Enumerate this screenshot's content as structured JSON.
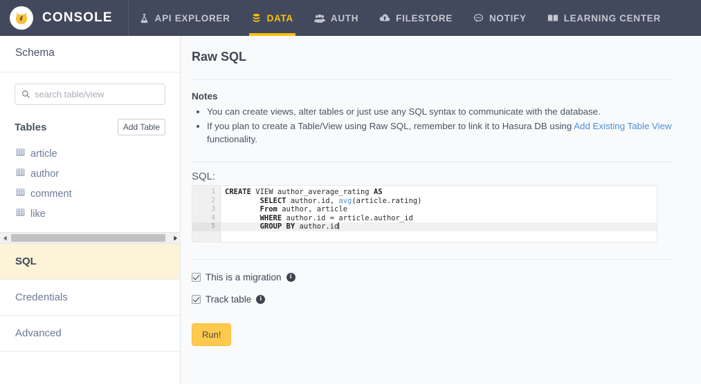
{
  "topnav": {
    "brand": "CONSOLE",
    "logo_icon": "hasura-mascot-icon",
    "accent_color": "#ffc107",
    "background_color": "#43495c",
    "items": [
      {
        "label": "API EXPLORER",
        "icon": "flask-icon",
        "active": false
      },
      {
        "label": "DATA",
        "icon": "database-icon",
        "active": true
      },
      {
        "label": "AUTH",
        "icon": "users-icon",
        "active": false
      },
      {
        "label": "FILESTORE",
        "icon": "cloud-upload-icon",
        "active": false
      },
      {
        "label": "NOTIFY",
        "icon": "chat-bubble-icon",
        "active": false
      },
      {
        "label": "LEARNING CENTER",
        "icon": "open-book-icon",
        "active": false
      }
    ]
  },
  "sidebar": {
    "header": "Schema",
    "search": {
      "placeholder": "search table/view",
      "value": "",
      "icon": "search-icon"
    },
    "tables_label": "Tables",
    "add_table_button": "Add Table",
    "tables": [
      {
        "name": "article",
        "icon": "table-icon"
      },
      {
        "name": "author",
        "icon": "table-icon"
      },
      {
        "name": "comment",
        "icon": "table-icon"
      },
      {
        "name": "like",
        "icon": "table-icon"
      }
    ],
    "scrollbar": {
      "left_icon": "caret-left-icon",
      "right_icon": "caret-right-icon"
    },
    "links": [
      {
        "label": "SQL",
        "active": true
      },
      {
        "label": "Credentials",
        "active": false
      },
      {
        "label": "Advanced",
        "active": false
      }
    ]
  },
  "main": {
    "title": "Raw SQL",
    "notes": {
      "title": "Notes",
      "items": [
        {
          "prefix": "You can create views, alter tables or just use any SQL syntax to communicate with the database.",
          "link": "",
          "suffix": ""
        },
        {
          "prefix": "If you plan to create a Table/View using Raw SQL, remember to link it to Hasura DB using ",
          "link": "Add Existing Table View",
          "suffix": " functionality."
        }
      ],
      "link_color": "#4a90d9"
    },
    "sql_label": "SQL:",
    "editor": {
      "line_numbers": [
        "1",
        "2",
        "3",
        "4",
        "5"
      ],
      "active_line": 5,
      "lines": [
        [
          {
            "t": "CREATE",
            "s": "kw"
          },
          {
            "t": " VIEW author_average_rating ",
            "s": ""
          },
          {
            "t": "AS",
            "s": "kw"
          }
        ],
        [
          {
            "t": "        ",
            "s": ""
          },
          {
            "t": "SELECT",
            "s": "kw"
          },
          {
            "t": " author.id, ",
            "s": ""
          },
          {
            "t": "avg",
            "s": "fn"
          },
          {
            "t": "(article.rating)",
            "s": ""
          }
        ],
        [
          {
            "t": "        ",
            "s": ""
          },
          {
            "t": "From",
            "s": "kw"
          },
          {
            "t": " author, article",
            "s": ""
          }
        ],
        [
          {
            "t": "        ",
            "s": ""
          },
          {
            "t": "WHERE",
            "s": "kw"
          },
          {
            "t": " author.id = article.author_id",
            "s": ""
          }
        ],
        [
          {
            "t": "        ",
            "s": ""
          },
          {
            "t": "GROUP BY",
            "s": "kw"
          },
          {
            "t": " author.id",
            "s": ""
          }
        ]
      ]
    },
    "options": [
      {
        "label": "This is a migration",
        "checked": true,
        "info_icon": "info-icon"
      },
      {
        "label": "Track table",
        "checked": true,
        "info_icon": "info-icon"
      }
    ],
    "run_button": {
      "label": "Run!",
      "color": "#ffc94d"
    }
  }
}
